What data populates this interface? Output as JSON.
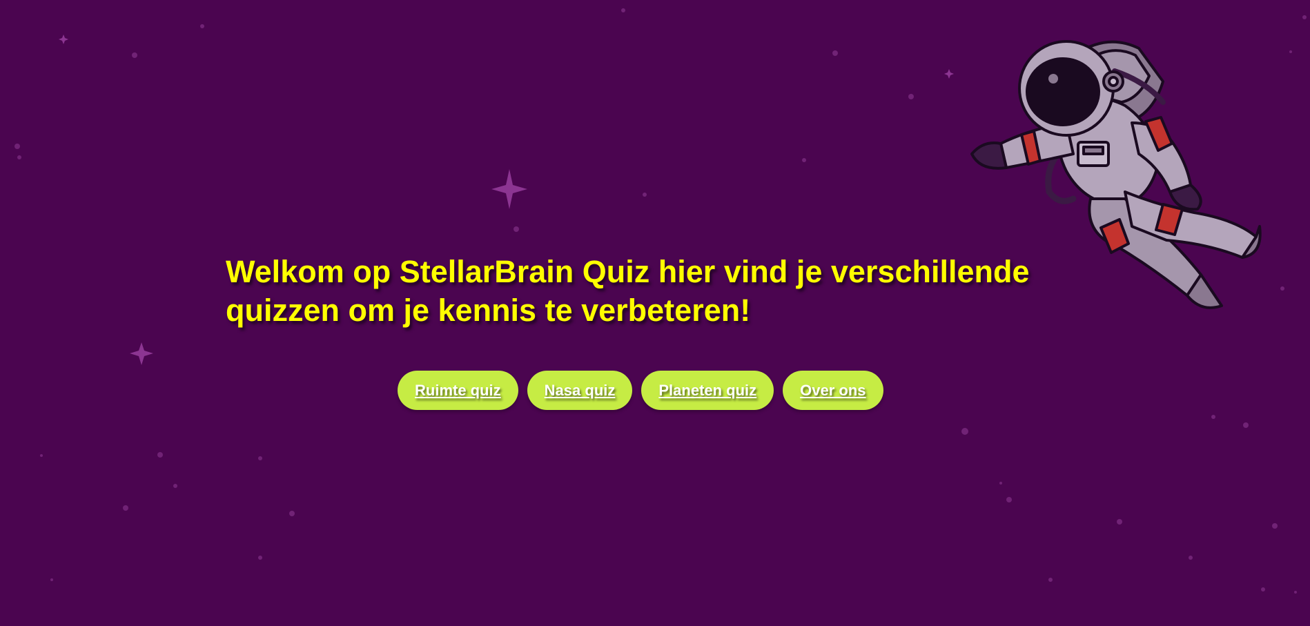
{
  "hero": {
    "welcome_text": "Welkom op StellarBrain Quiz hier vind je verschillende quizzen om je kennis te verbeteren!"
  },
  "nav": {
    "items": [
      {
        "label": "Ruimte quiz"
      },
      {
        "label": "Nasa quiz"
      },
      {
        "label": "Planeten quiz"
      },
      {
        "label": "Over ons"
      }
    ]
  },
  "colors": {
    "background": "#4b0550",
    "heading": "#ffff00",
    "button": "#c6ec44",
    "button_text": "#ffffff"
  },
  "decor": {
    "illustration": "astronaut-illustration",
    "background_icon": "star-icon"
  }
}
